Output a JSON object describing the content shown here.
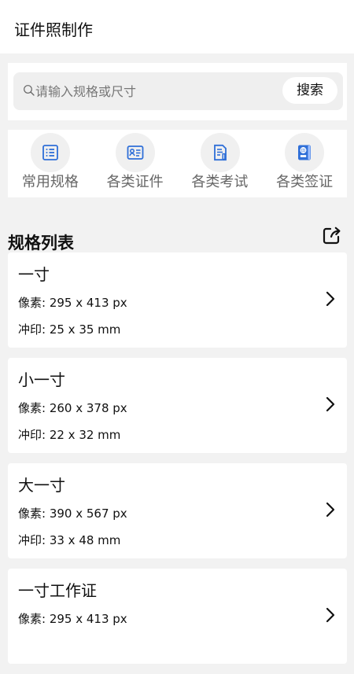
{
  "header": {
    "title": "证件照制作"
  },
  "search": {
    "placeholder": "请输入规格或尺寸",
    "button_label": "搜索"
  },
  "categories": [
    {
      "label": "常用规格",
      "icon": "list-icon",
      "color": "#2f6fd8"
    },
    {
      "label": "各类证件",
      "icon": "id-card-icon",
      "color": "#2f6fd8"
    },
    {
      "label": "各类考试",
      "icon": "exam-document-icon",
      "color": "#2f6fd8"
    },
    {
      "label": "各类签证",
      "icon": "passport-icon",
      "color": "#2f6fd8"
    }
  ],
  "section": {
    "title": "规格列表",
    "share_icon": "share-icon"
  },
  "specs": [
    {
      "name": "一寸",
      "pixel": "像素: 295 x 413 px",
      "print": "冲印: 25 x 35 mm"
    },
    {
      "name": "小一寸",
      "pixel": "像素: 260 x 378 px",
      "print": "冲印: 22 x 32 mm"
    },
    {
      "name": "大一寸",
      "pixel": "像素: 390 x 567 px",
      "print": "冲印: 33 x 48 mm"
    },
    {
      "name": "一寸工作证",
      "pixel": "像素: 295 x 413 px",
      "print": ""
    }
  ],
  "colors": {
    "background": "#f2f2f2",
    "surface": "#ffffff",
    "search_field": "#efefef",
    "icon_blue": "#2f6fd8",
    "text_primary": "#111111",
    "text_secondary": "#666666"
  }
}
